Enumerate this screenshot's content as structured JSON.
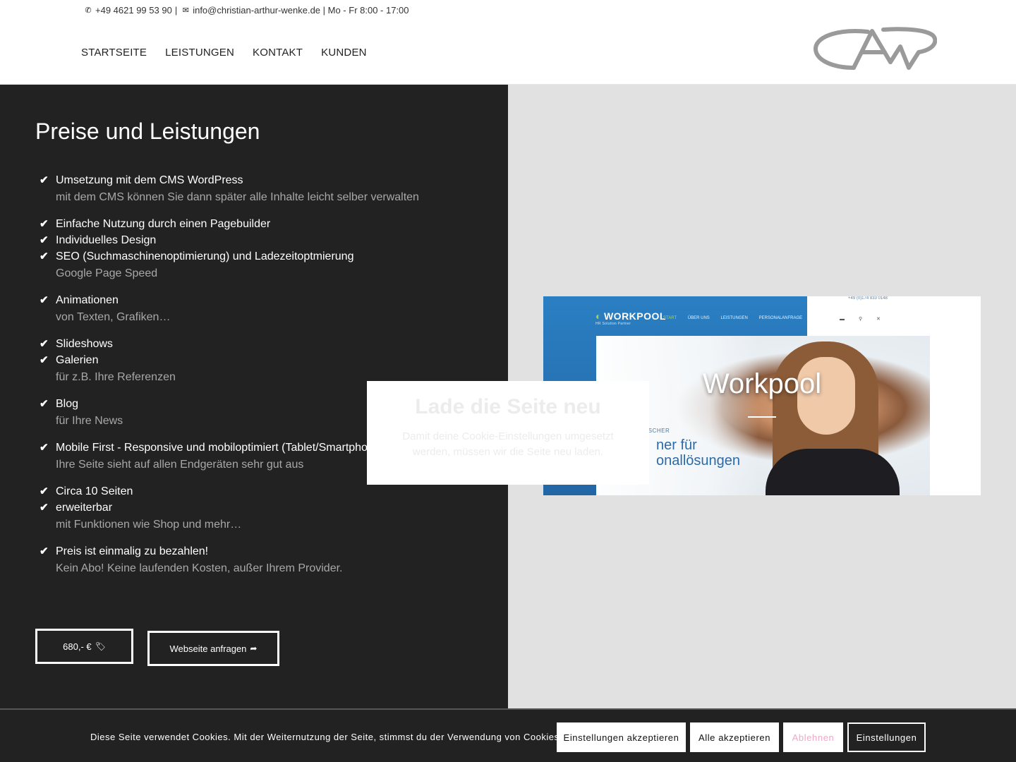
{
  "header": {
    "phone": "+49 4621 99 53 90",
    "separator": "|",
    "email_hours": "info@christian-arthur-wenke.de | Mo - Fr 8:00 - 17:00",
    "phone_icon": "phone-icon",
    "mail_icon": "mail-icon",
    "nav": [
      "STARTSEITE",
      "LEISTUNGEN",
      "KONTAKT",
      "KUNDEN"
    ],
    "logo_letters": "CAW",
    "logo_color": "#9a9a9a"
  },
  "main": {
    "heading": "Preise und Leistungen",
    "features": [
      {
        "title": "Umsetzung mit dem CMS WordPress",
        "sub": "mit dem CMS können Sie dann später alle Inhalte leicht selber verwalten"
      },
      {
        "title": "Einfache Nutzung durch einen Pagebuilder",
        "sub": ""
      },
      {
        "title": "Individuelles Design",
        "sub": ""
      },
      {
        "title": "SEO (Suchmaschinenoptimierung) und Ladezeitoptmierung",
        "sub": "Google Page Speed"
      },
      {
        "title": "Animationen",
        "sub": "von Texten, Grafiken…"
      },
      {
        "title": "Slideshows",
        "sub": ""
      },
      {
        "title": "Galerien",
        "sub": "für z.B. Ihre Referenzen"
      },
      {
        "title": "Blog",
        "sub": "für Ihre News"
      },
      {
        "title": "Mobile First - Responsive und mobiloptimiert (Tablet/Smartphone)",
        "sub": "Ihre Seite sieht auf allen Endgeräten sehr gut aus"
      },
      {
        "title": "Circa 10 Seiten",
        "sub": ""
      },
      {
        "title": "erweiterbar",
        "sub": "mit Funktionen wie Shop und mehr…"
      },
      {
        "title": "Preis ist einmalig zu bezahlen!",
        "sub": "Kein Abo! Keine laufenden Kosten, außer Ihrem Provider."
      }
    ],
    "check_icon": "✔",
    "price_button": "680,- €",
    "price_icon": "tag-icon",
    "request_button": "Webseite anfragen",
    "request_icon": "share-arrow-icon"
  },
  "preview": {
    "title": "Workpool",
    "logo": "WORKPOOL",
    "logo_sub": "HR Solution Partner",
    "nav": [
      "START",
      "ÜBER UNS",
      "LEISTUNGEN",
      "PERSONALANFRAGE"
    ],
    "phone": "+49 (0)174 833 0148",
    "tag": "ISCHER",
    "headline_1": "ner für",
    "headline_2": "onallösungen",
    "accent_color": "#2a7fc2"
  },
  "modal": {
    "title": "Lade die Seite neu",
    "text": "Damit deine Cookie-Einstellungen umgesetzt werden, müssen wir die Seite neu laden."
  },
  "cookie": {
    "text": "Diese Seite verwendet Cookies. Mit der Weiternutzung der Seite, stimmst du der Verwendung von Cookies zu.",
    "buttons": [
      "Einstellungen akzeptieren",
      "Alle akzeptieren",
      "Ablehnen",
      "Einstellungen"
    ]
  }
}
